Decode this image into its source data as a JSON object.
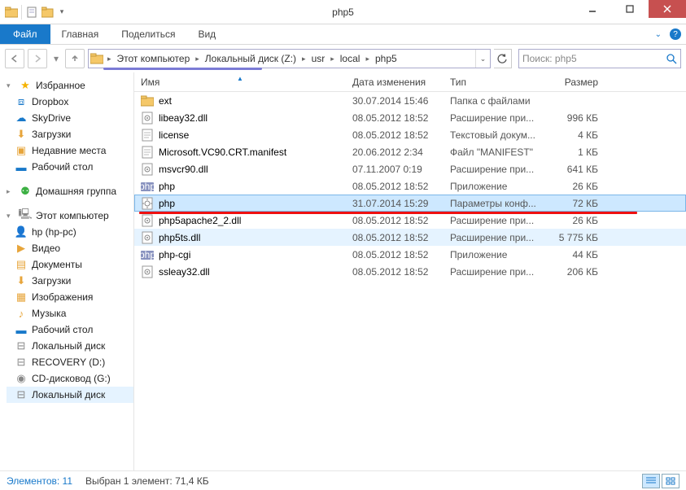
{
  "window": {
    "title": "php5"
  },
  "ribbon": {
    "file": "Файл",
    "tabs": [
      "Главная",
      "Поделиться",
      "Вид"
    ]
  },
  "breadcrumbs": [
    "Этот компьютер",
    "Локальный диск (Z:)",
    "usr",
    "local",
    "php5"
  ],
  "search": {
    "placeholder": "Поиск: php5"
  },
  "sidebar": {
    "favorites": {
      "label": "Избранное",
      "items": [
        {
          "icon": "dropbox",
          "label": "Dropbox"
        },
        {
          "icon": "skydrive",
          "label": "SkyDrive"
        },
        {
          "icon": "downloads",
          "label": "Загрузки"
        },
        {
          "icon": "recent",
          "label": "Недавние места"
        },
        {
          "icon": "desktop",
          "label": "Рабочий стол"
        }
      ]
    },
    "homegroup": {
      "label": "Домашняя группа"
    },
    "thispc": {
      "label": "Этот компьютер",
      "items": [
        {
          "icon": "user",
          "label": "hp (hp-pc)"
        },
        {
          "icon": "video",
          "label": "Видео"
        },
        {
          "icon": "docs",
          "label": "Документы"
        },
        {
          "icon": "downloads",
          "label": "Загрузки"
        },
        {
          "icon": "images",
          "label": "Изображения"
        },
        {
          "icon": "music",
          "label": "Музыка"
        },
        {
          "icon": "desktop",
          "label": "Рабочий стол"
        },
        {
          "icon": "disk",
          "label": "Локальный диск"
        },
        {
          "icon": "disk",
          "label": "RECOVERY (D:)"
        },
        {
          "icon": "cd",
          "label": "CD-дисковод (G:)"
        },
        {
          "icon": "disk",
          "label": "Локальный диск"
        }
      ]
    }
  },
  "columns": {
    "name": "Имя",
    "date": "Дата изменения",
    "type": "Тип",
    "size": "Размер"
  },
  "files": [
    {
      "icon": "folder",
      "name": "ext",
      "date": "30.07.2014 15:46",
      "type": "Папка с файлами",
      "size": "",
      "state": ""
    },
    {
      "icon": "dll",
      "name": "libeay32.dll",
      "date": "08.05.2012 18:52",
      "type": "Расширение при...",
      "size": "996 КБ",
      "state": ""
    },
    {
      "icon": "txt",
      "name": "license",
      "date": "08.05.2012 18:52",
      "type": "Текстовый докум...",
      "size": "4 КБ",
      "state": ""
    },
    {
      "icon": "txt",
      "name": "Microsoft.VC90.CRT.manifest",
      "date": "20.06.2012 2:34",
      "type": "Файл \"MANIFEST\"",
      "size": "1 КБ",
      "state": ""
    },
    {
      "icon": "dll",
      "name": "msvcr90.dll",
      "date": "07.11.2007 0:19",
      "type": "Расширение при...",
      "size": "641 КБ",
      "state": ""
    },
    {
      "icon": "php",
      "name": "php",
      "date": "08.05.2012 18:52",
      "type": "Приложение",
      "size": "26 КБ",
      "state": ""
    },
    {
      "icon": "ini",
      "name": "php",
      "date": "31.07.2014 15:29",
      "type": "Параметры конф...",
      "size": "72 КБ",
      "state": "sel"
    },
    {
      "icon": "dll",
      "name": "php5apache2_2.dll",
      "date": "08.05.2012 18:52",
      "type": "Расширение при...",
      "size": "26 КБ",
      "state": ""
    },
    {
      "icon": "dll",
      "name": "php5ts.dll",
      "date": "08.05.2012 18:52",
      "type": "Расширение при...",
      "size": "5 775 КБ",
      "state": "hl"
    },
    {
      "icon": "php",
      "name": "php-cgi",
      "date": "08.05.2012 18:52",
      "type": "Приложение",
      "size": "44 КБ",
      "state": ""
    },
    {
      "icon": "dll",
      "name": "ssleay32.dll",
      "date": "08.05.2012 18:52",
      "type": "Расширение при...",
      "size": "206 КБ",
      "state": ""
    }
  ],
  "status": {
    "elements": "Элементов: 11",
    "selected": "Выбран 1 элемент: 71,4 КБ"
  }
}
